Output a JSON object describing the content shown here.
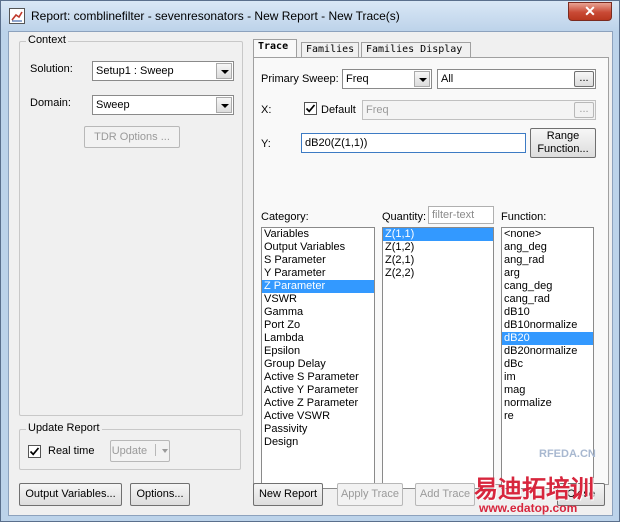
{
  "window": {
    "title": "Report: comblinefilter - sevenresonators - New Report - New Trace(s)",
    "close_label": "✕"
  },
  "context": {
    "legend": "Context",
    "solution_label": "Solution:",
    "solution_value": "Setup1 : Sweep",
    "domain_label": "Domain:",
    "domain_value": "Sweep",
    "tdr_button": "TDR Options ..."
  },
  "update_report": {
    "legend": "Update Report",
    "realtime_label": "Real time",
    "realtime_checked": true,
    "update_button": "Update"
  },
  "bottom_left": {
    "output_variables_button": "Output Variables...",
    "options_button": "Options..."
  },
  "tabs": [
    {
      "label": "Trace",
      "active": true
    },
    {
      "label": "Families",
      "active": false
    },
    {
      "label": "Families Display",
      "active": false
    }
  ],
  "trace": {
    "primary_sweep_label": "Primary Sweep:",
    "primary_sweep_value": "Freq",
    "primary_sweep_range": "All",
    "ellipsis": "...",
    "x_label": "X:",
    "x_default_label": "Default",
    "x_default_checked": true,
    "x_value": "Freq",
    "y_label": "Y:",
    "y_value": "dB20(Z(1,1))",
    "range_function_line1": "Range",
    "range_function_line2": "Function..."
  },
  "category": {
    "label": "Category:",
    "items": [
      "Variables",
      "Output Variables",
      "S Parameter",
      "Y Parameter",
      "Z Parameter",
      "VSWR",
      "Gamma",
      "Port Zo",
      "Lambda",
      "Epsilon",
      "Group Delay",
      "Active S Parameter",
      "Active Y Parameter",
      "Active Z Parameter",
      "Active VSWR",
      "Passivity",
      "Design"
    ],
    "selected_index": 4
  },
  "quantity": {
    "label": "Quantity:",
    "filter_placeholder": "filter-text",
    "items": [
      "Z(1,1)",
      "Z(1,2)",
      "Z(2,1)",
      "Z(2,2)"
    ],
    "selected_index": 0
  },
  "function": {
    "label": "Function:",
    "items": [
      "<none>",
      "ang_deg",
      "ang_rad",
      "arg",
      "cang_deg",
      "cang_rad",
      "dB10",
      "dB10normalize",
      "dB20",
      "dB20normalize",
      "dBc",
      "im",
      "mag",
      "normalize",
      "re"
    ],
    "selected_index": 8
  },
  "bottom_right": {
    "new_report": "New Report",
    "apply_trace": "Apply Trace",
    "add_trace": "Add Trace",
    "close": "Close"
  },
  "watermark": {
    "line1": "易迪拓培训",
    "line2": "www.edatop.com",
    "line3": "RFEDA.CN"
  },
  "colors": {
    "selection": "#3399ff",
    "titlebar": "#bdd3ea",
    "close": "#c94a35",
    "watermark_red": "#d7263d"
  }
}
